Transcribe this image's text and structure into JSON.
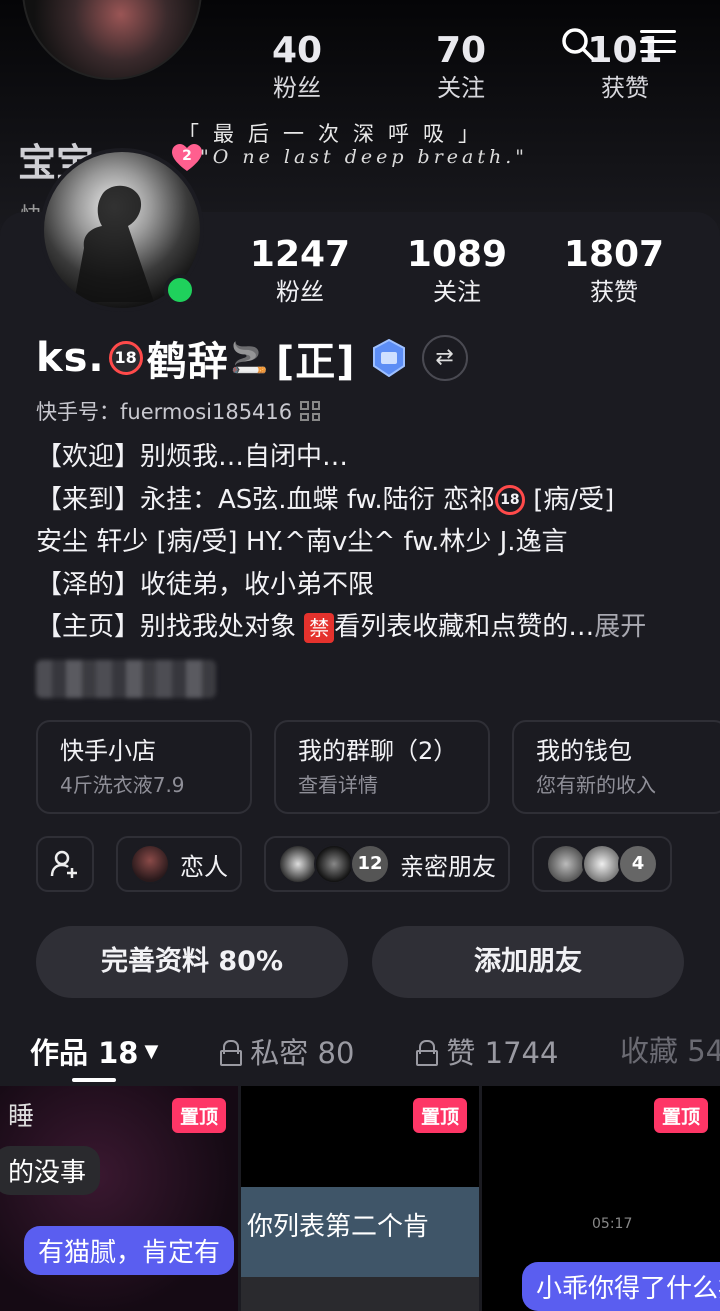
{
  "background_header": {
    "stats": [
      {
        "num": "40",
        "label": "粉丝"
      },
      {
        "num": "70",
        "label": "关注"
      },
      {
        "num": "101",
        "label": "获赞"
      }
    ],
    "name": "宝宝",
    "poem_cn": "「最后一次深呼吸」",
    "poem_en": "\"O ne last deep breath.\"",
    "heart_count": "2",
    "sub_text": "快   4582"
  },
  "profile": {
    "stats": [
      {
        "num": "1247",
        "label": "粉丝"
      },
      {
        "num": "1089",
        "label": "关注"
      },
      {
        "num": "1807",
        "label": "获赞"
      }
    ],
    "name_prefix": "ks.",
    "age_badge": "18",
    "name_mid": "鹤辞",
    "cigarette": "🚬",
    "name_suffix": "[正]",
    "kuaishou_id": "快手号：fuermosi185416",
    "bio": {
      "line1": "【欢迎】别烦我…自闭中…",
      "line2_a": "【来到】永挂：AS弦.血蝶   fw.陆衍   恋祁",
      "line2_b": "[病/受]",
      "line3": "安尘   轩少 [病/受] HY.^南v尘^   fw.林少    J.逸言",
      "line4": "【泽的】收徒弟，收小弟不限",
      "line5_a": "【主页】别找我处对象 ",
      "line5_jin": "禁",
      "line5_b": "看列表收藏和点赞的…",
      "expand": "展开"
    }
  },
  "tiles": [
    {
      "title": "快手小店",
      "sub": "4斤洗衣液7.9"
    },
    {
      "title": "我的群聊（2）",
      "sub": "查看详情"
    },
    {
      "title": "我的钱包",
      "sub": "您有新的收入"
    }
  ],
  "chips": {
    "lover_label": "恋人",
    "close_friends_count": "12",
    "close_friends_label": "亲密朋友",
    "more_count": "4"
  },
  "buttons": {
    "complete_profile": "完善资料 80%",
    "add_friend": "添加朋友"
  },
  "tabs": {
    "works": "作品 18",
    "private": "私密 80",
    "likes": "赞 1744",
    "favorites": "收藏 54"
  },
  "grid": {
    "pin_label": "置顶",
    "cell1_texts": [
      "睡",
      "的没事",
      "有猫腻，肯定有"
    ],
    "cell2_text": "你列表第二个肯",
    "cell3_time": "05:17",
    "cell3_text": "小乖你得了什么病"
  },
  "colors": {
    "background": "#1b1b21",
    "card_border": "#2f2f36",
    "online": "#1fd15c",
    "pin": "#fe3666",
    "badge_red": "#ff4a4a"
  }
}
